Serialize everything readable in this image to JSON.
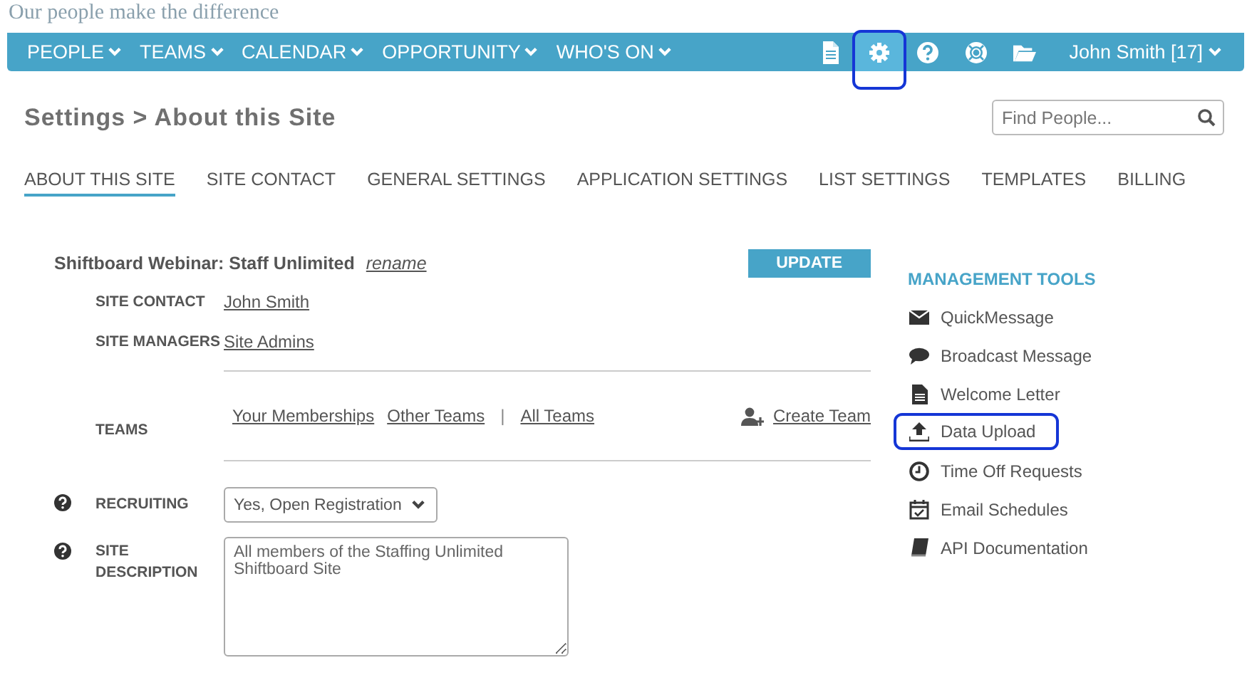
{
  "tagline": "Our people make the difference",
  "nav": {
    "menus": [
      {
        "label": "PEOPLE"
      },
      {
        "label": "TEAMS"
      },
      {
        "label": "CALENDAR"
      },
      {
        "label": "OPPORTUNITY"
      },
      {
        "label": "WHO'S ON"
      }
    ],
    "icons": [
      {
        "selected": false,
        "highlighted": false
      },
      {
        "selected": true,
        "highlighted": true
      },
      {
        "selected": false,
        "highlighted": false
      },
      {
        "selected": false,
        "highlighted": false
      },
      {
        "selected": false,
        "highlighted": false
      }
    ],
    "user": "John Smith [17]"
  },
  "page_title": "Settings > About this Site",
  "search": {
    "placeholder": "Find People..."
  },
  "tabs": [
    {
      "label": "ABOUT THIS SITE",
      "selected": true
    },
    {
      "label": "SITE CONTACT",
      "selected": false
    },
    {
      "label": "GENERAL SETTINGS",
      "selected": false
    },
    {
      "label": "APPLICATION SETTINGS",
      "selected": false
    },
    {
      "label": "LIST SETTINGS",
      "selected": false
    },
    {
      "label": "TEMPLATES",
      "selected": false
    },
    {
      "label": "BILLING",
      "selected": false
    }
  ],
  "site": {
    "name": "Shiftboard Webinar: Staff Unlimited",
    "rename": "rename",
    "update": "UPDATE"
  },
  "site_contact": {
    "label": "SITE CONTACT",
    "value": "John Smith"
  },
  "site_managers": {
    "label": "SITE MANAGERS",
    "value": "Site Admins"
  },
  "teams": {
    "label": "TEAMS",
    "links": [
      "Your Memberships",
      "Other Teams"
    ],
    "separator": "|",
    "all": "All Teams",
    "create": "Create Team"
  },
  "recruiting": {
    "label": "RECRUITING",
    "value": "Yes, Open Registration"
  },
  "description": {
    "label": "SITE DESCRIPTION",
    "value": "All members of the Staffing Unlimited\nShiftboard Site"
  },
  "tools": {
    "title": "MANAGEMENT TOOLS",
    "items": [
      {
        "label": "QuickMessage",
        "highlighted": false
      },
      {
        "label": "Broadcast Message",
        "highlighted": false
      },
      {
        "label": "Welcome Letter",
        "highlighted": false
      },
      {
        "label": "Data Upload",
        "highlighted": true
      },
      {
        "label": "Time Off Requests",
        "highlighted": false
      },
      {
        "label": "Email Schedules",
        "highlighted": false
      },
      {
        "label": "API Documentation",
        "highlighted": false
      }
    ]
  }
}
